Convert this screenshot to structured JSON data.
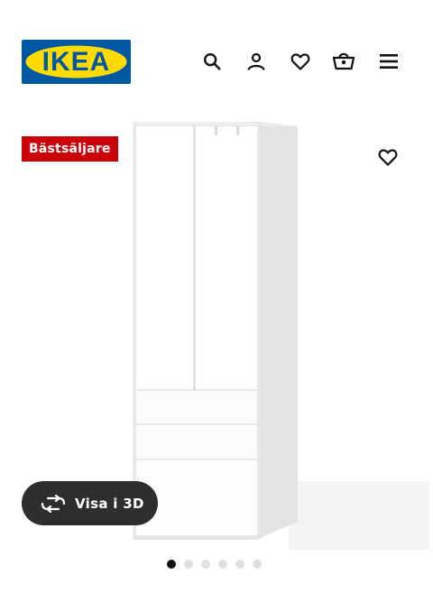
{
  "brand": {
    "logo_text": "IKEA",
    "colors": {
      "blue": "#0058a3",
      "yellow": "#ffdb00"
    }
  },
  "header": {
    "icons": [
      "search-icon",
      "user-icon",
      "heart-icon",
      "shopping-bag-icon",
      "menu-icon"
    ]
  },
  "product": {
    "badge_label": "Bästsäljare",
    "badge_color": "#cc0008",
    "favourite_icon": "heart-icon",
    "view_3d_label": "Visa i 3D",
    "view_3d_icon": "rotate-360-icon"
  },
  "carousel": {
    "total": 6,
    "active_index": 0
  }
}
